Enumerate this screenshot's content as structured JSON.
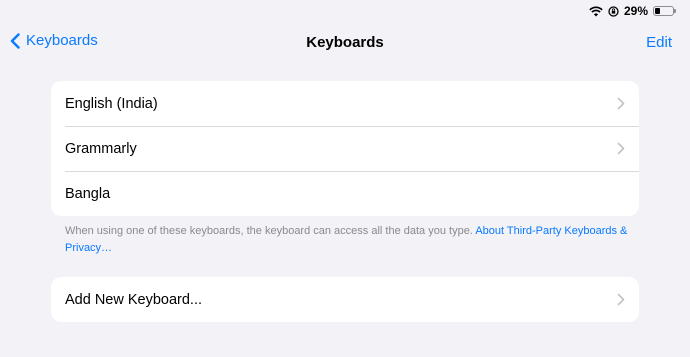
{
  "status_bar": {
    "battery_percent": "29%",
    "battery_level": 0.29,
    "icons": [
      "wifi-icon",
      "orientation-lock-icon",
      "battery-icon"
    ]
  },
  "nav": {
    "back_label": "Keyboards",
    "title": "Keyboards",
    "edit_label": "Edit"
  },
  "keyboards": [
    {
      "label": "English (India)",
      "has_chevron": true
    },
    {
      "label": "Grammarly",
      "has_chevron": true
    },
    {
      "label": "Bangla",
      "has_chevron": false
    }
  ],
  "footnote": {
    "text": "When using one of these keyboards, the keyboard can access all the data you type. ",
    "link": "About Third-Party Keyboards & Privacy…"
  },
  "add_keyboard": {
    "label": "Add New Keyboard..."
  },
  "colors": {
    "accent": "#0a7aff",
    "background": "#f2f2f7",
    "secondary_text": "#8a8a8e"
  }
}
